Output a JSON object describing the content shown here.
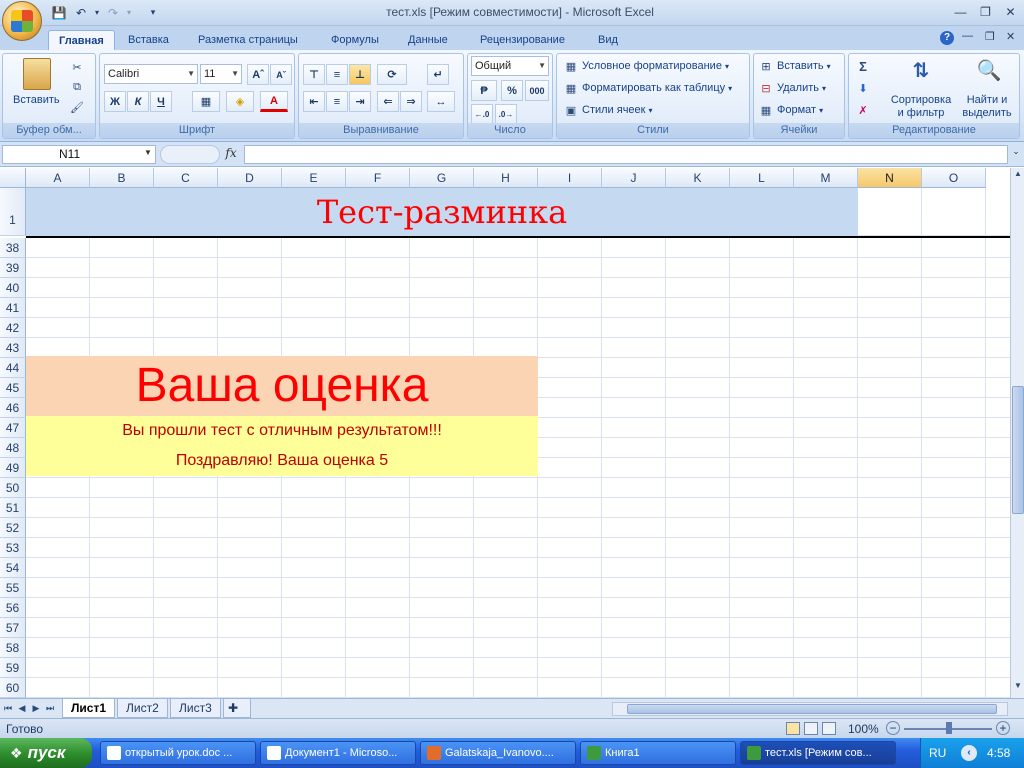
{
  "window": {
    "title": "тест.xls  [Режим совместимости] - Microsoft Excel"
  },
  "ribbon": {
    "tabs": [
      "Главная",
      "Вставка",
      "Разметка страницы",
      "Формулы",
      "Данные",
      "Рецензирование",
      "Вид"
    ],
    "active_tab": "Главная",
    "clipboard": {
      "paste": "Вставить",
      "label": "Буфер обм..."
    },
    "font": {
      "name": "Calibri",
      "size": "11",
      "bold": "Ж",
      "italic": "К",
      "underline": "Ч",
      "label": "Шрифт"
    },
    "alignment": {
      "label": "Выравнивание"
    },
    "number": {
      "format": "Общий",
      "percent": "%",
      "thousands": "000",
      "label": "Число"
    },
    "styles": {
      "conditional": "Условное форматирование",
      "as_table": "Форматировать как таблицу",
      "cell_styles": "Стили ячеек",
      "label": "Стили"
    },
    "cells": {
      "insert": "Вставить",
      "delete": "Удалить",
      "format": "Формат",
      "label": "Ячейки"
    },
    "editing": {
      "sort_line1": "Сортировка",
      "sort_line2": "и фильтр",
      "find_line1": "Найти и",
      "find_line2": "выделить",
      "label": "Редактирование"
    }
  },
  "formula_bar": {
    "name_box": "N11",
    "fx": "fx",
    "value": ""
  },
  "grid": {
    "columns": [
      "A",
      "B",
      "C",
      "D",
      "E",
      "F",
      "G",
      "H",
      "I",
      "J",
      "K",
      "L",
      "M",
      "N",
      "O"
    ],
    "selected_column": "N",
    "rows": [
      "1",
      "38",
      "39",
      "40",
      "41",
      "42",
      "43",
      "44",
      "45",
      "46",
      "47",
      "48",
      "49",
      "50",
      "51",
      "52",
      "53",
      "54",
      "55",
      "56",
      "57",
      "58",
      "59",
      "60"
    ]
  },
  "content": {
    "title": "Тест-разминка",
    "grade_heading": "Ваша оценка",
    "message_line1": "Вы прошли тест с отличным результатом!!!",
    "message_line2": "Поздравляю! Ваша оценка 5"
  },
  "sheets": {
    "tabs": [
      "Лист1",
      "Лист2",
      "Лист3"
    ],
    "active": "Лист1"
  },
  "status": {
    "ready": "Готово",
    "zoom": "100%"
  },
  "taskbar": {
    "start": "пуск",
    "tasks": [
      "открытый урок.doc ...",
      "Документ1 - Microso...",
      "Galatskaja_Ivanovo....",
      "Книга1",
      "тест.xls  [Режим сов..."
    ],
    "active_task": "тест.xls  [Режим сов...",
    "language": "RU",
    "clock": "4:58"
  },
  "colors": {
    "title_text": "#ff0000",
    "title_fill": "#c5d9f1",
    "grade_fill": "#fbd4b4",
    "message_fill": "#ffff99",
    "message_text": "#c00000"
  }
}
